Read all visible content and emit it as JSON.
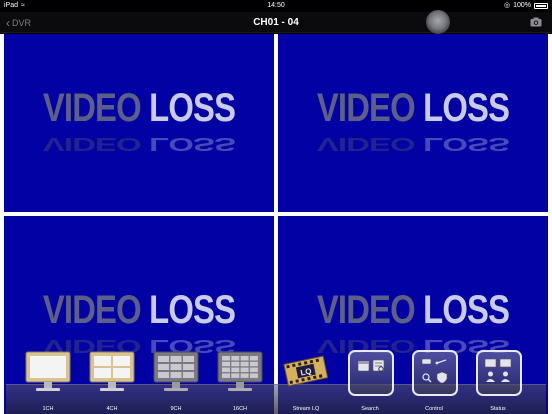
{
  "statusbar": {
    "device": "iPad",
    "time": "14:50",
    "battery": "100%"
  },
  "nav": {
    "back_label": "DVR",
    "title": "CH01 - 04"
  },
  "tiles": [
    {
      "word1": "VIDEO",
      "word2": "LOSS"
    },
    {
      "word1": "VIDEO",
      "word2": "LOSS"
    },
    {
      "word1": "VIDEO",
      "word2": "LOSS"
    },
    {
      "word1": "VIDEO",
      "word2": "LOSS"
    }
  ],
  "toolbar": {
    "items": [
      {
        "label": "1CH"
      },
      {
        "label": "4CH"
      },
      {
        "label": "9CH"
      },
      {
        "label": "16CH"
      },
      {
        "label": "Stream LQ"
      },
      {
        "label": "Search"
      },
      {
        "label": "Control"
      },
      {
        "label": "Status"
      }
    ]
  },
  "colors": {
    "video_bg": "#0201a3",
    "divider": "#ffffff",
    "navbar": "#0b0b0d"
  }
}
